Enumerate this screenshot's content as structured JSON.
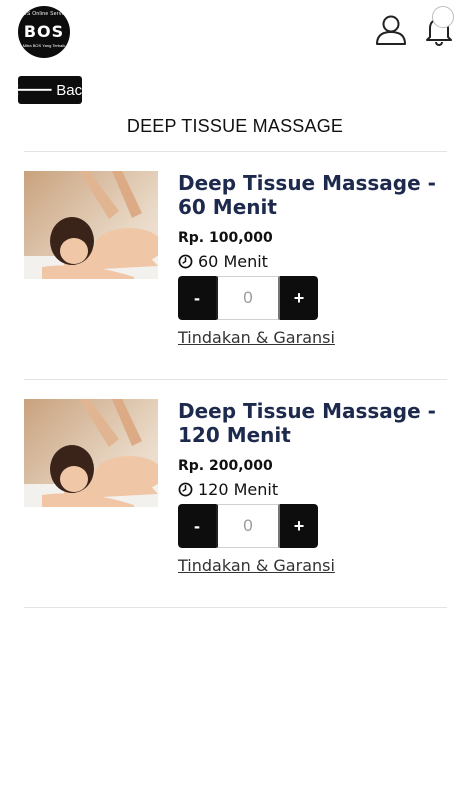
{
  "header": {
    "logo": {
      "top_text": "BOS Online Service",
      "mark": "BOS",
      "bottom_text": "Mitra BOS Yang Terbaik"
    },
    "icons": [
      "profile-icon",
      "bell-icon"
    ]
  },
  "back_label": "Back",
  "page_title": "DEEP TISSUE MASSAGE",
  "products": [
    {
      "name": "Deep Tissue Massage - 60 Menit",
      "price": "Rp. 100,000",
      "duration": "60 Menit",
      "quantity": "0",
      "minus_label": "-",
      "plus_label": "+",
      "terms_label": "Tindakan & Garansi"
    },
    {
      "name": "Deep Tissue Massage - 120 Menit",
      "price": "Rp. 200,000",
      "duration": "120 Menit",
      "quantity": "0",
      "minus_label": "-",
      "plus_label": "+",
      "terms_label": "Tindakan & Garansi"
    }
  ],
  "colors": {
    "accent": "#0d0d0d",
    "title_text": "#1d2a4d",
    "logo_red": "#d62828"
  }
}
